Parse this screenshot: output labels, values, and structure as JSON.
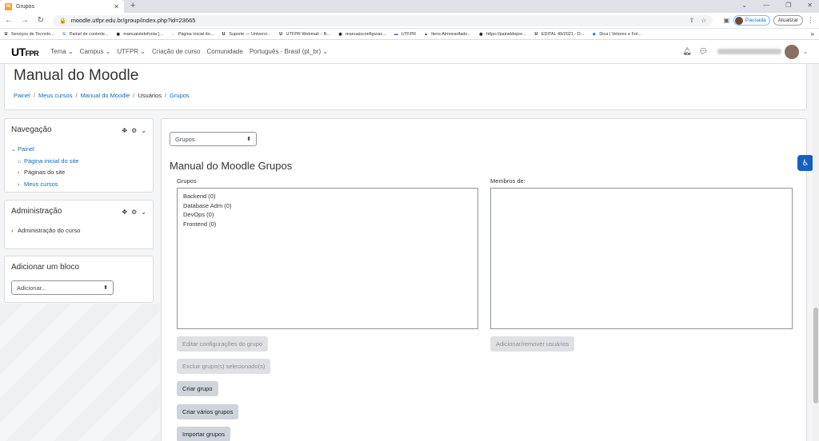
{
  "browser": {
    "tab_title": "Grupos",
    "tab_favicon": "UTF",
    "url": "moodle.utfpr.edu.br/group/index.php?id=23665",
    "profile_label": "Pausada",
    "update_label": "Atualizar",
    "bookmarks": [
      {
        "icon": "UTF",
        "label": "Serviços de Tecnolo..."
      },
      {
        "icon": "G",
        "label": "Painel de controle..."
      },
      {
        "icon": "globe",
        "label": "manuaistelefonia [..."
      },
      {
        "icon": "TF",
        "label": "Página inicial do..."
      },
      {
        "icon": "UTF",
        "label": "Suporte — Universi..."
      },
      {
        "icon": "UTF",
        "label": "UTFPR Webmail :: B..."
      },
      {
        "icon": "globe",
        "label": "manuaisconfigurac..."
      },
      {
        "icon": "flag",
        "label": "UTFPR"
      },
      {
        "icon": "img",
        "label": "Itens Almoxarifado..."
      },
      {
        "icon": "globe",
        "label": "https://paineldepre..."
      },
      {
        "icon": "UTF",
        "label": "EDITAL 49/2021 - D..."
      },
      {
        "icon": "vec",
        "label": "Dica | Vetores e Fot..."
      }
    ]
  },
  "moodle_nav": {
    "logo_text": "UT",
    "logo_suffix": "FPR",
    "links": [
      "Tema ⌄",
      "Campus ⌄",
      "UTFPR ⌄",
      "Criação de curso",
      "Comunidade",
      "Português - Brasil (pt_br) ⌄"
    ]
  },
  "header": {
    "title": "Manual do Moodle",
    "breadcrumb": [
      {
        "label": "Painel",
        "link": true
      },
      {
        "label": "Meus cursos",
        "link": true
      },
      {
        "label": "Manual do Moodle",
        "link": true
      },
      {
        "label": "Usuários",
        "link": false
      },
      {
        "label": "Grupos",
        "link": true
      }
    ]
  },
  "navigation_block": {
    "title": "Navegação",
    "items": [
      {
        "label": "Painel",
        "caret": "⌄",
        "link": true,
        "indent": 0
      },
      {
        "label": "Página inicial do site",
        "caret": "⌂",
        "link": true,
        "indent": 1
      },
      {
        "label": "Páginas do site",
        "caret": "›",
        "link": false,
        "indent": 1
      },
      {
        "label": "Meus cursos",
        "caret": "›",
        "link": true,
        "indent": 1
      }
    ]
  },
  "admin_block": {
    "title": "Administração",
    "items": [
      {
        "label": "Administração do curso"
      }
    ]
  },
  "add_block": {
    "title": "Adicionar um bloco",
    "select_value": "Adicionar..."
  },
  "main": {
    "view_select": "Grupos",
    "title": "Manual do Moodle Grupos",
    "groups_label": "Grupos",
    "members_label": "Membros de:",
    "groups": [
      "Backend (0)",
      "Database Adm (0)",
      "DevOps (0)",
      "Frontend (0)"
    ],
    "buttons": {
      "edit_group": "Editar configurações do grupo",
      "delete_groups": "Excluir grupo(s) selecionado(s)",
      "create_group": "Criar grupo",
      "create_groups": "Criar vários grupos",
      "import_groups": "Importar grupos",
      "add_remove_users": "Adicionar/remover usuários"
    }
  },
  "colors": {
    "link": "#0f6cbf",
    "accessibility": "#1560bd"
  }
}
